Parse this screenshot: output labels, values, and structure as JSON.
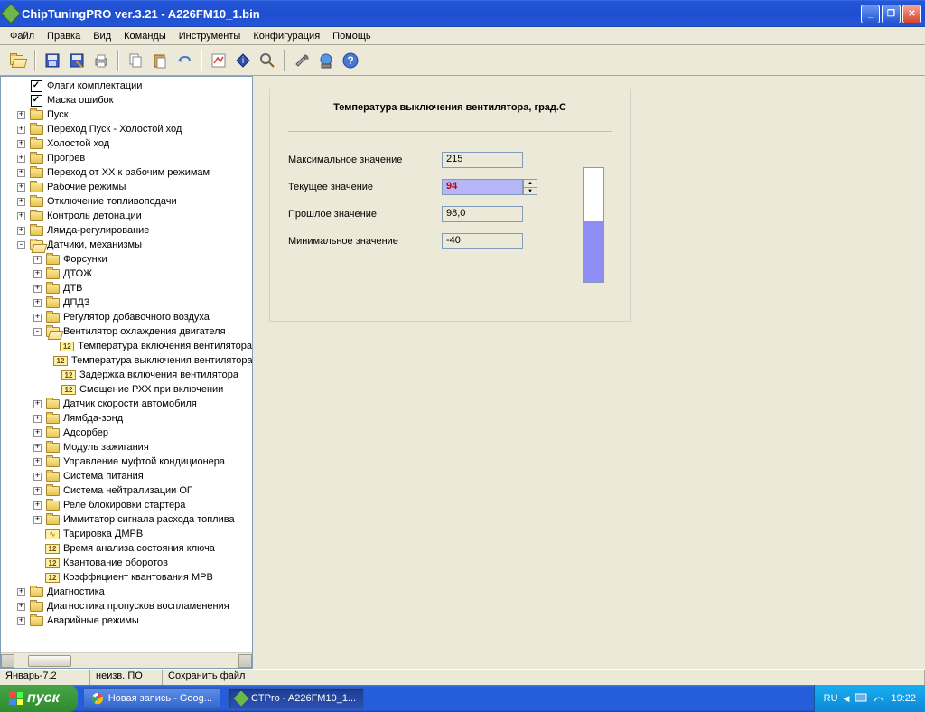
{
  "window": {
    "title": "ChipTuningPRO ver.3.21 - A226FM10_1.bin"
  },
  "menu": [
    "Файл",
    "Правка",
    "Вид",
    "Команды",
    "Инструменты",
    "Конфигурация",
    "Помощь"
  ],
  "tree": [
    {
      "lvl": 1,
      "exp": "",
      "icon": "check",
      "label": "Флаги комплектации"
    },
    {
      "lvl": 1,
      "exp": "",
      "icon": "check",
      "label": "Маска ошибок"
    },
    {
      "lvl": 1,
      "exp": "+",
      "icon": "fc",
      "label": "Пуск"
    },
    {
      "lvl": 1,
      "exp": "+",
      "icon": "fc",
      "label": "Переход Пуск - Холостой ход"
    },
    {
      "lvl": 1,
      "exp": "+",
      "icon": "fc",
      "label": "Холостой ход"
    },
    {
      "lvl": 1,
      "exp": "+",
      "icon": "fc",
      "label": "Прогрев"
    },
    {
      "lvl": 1,
      "exp": "+",
      "icon": "fc",
      "label": "Переход от XX к рабочим режимам"
    },
    {
      "lvl": 1,
      "exp": "+",
      "icon": "fc",
      "label": "Рабочие режимы"
    },
    {
      "lvl": 1,
      "exp": "+",
      "icon": "fc",
      "label": "Отключение топливоподачи"
    },
    {
      "lvl": 1,
      "exp": "+",
      "icon": "fc",
      "label": "Контроль детонации"
    },
    {
      "lvl": 1,
      "exp": "+",
      "icon": "fc",
      "label": "Лямда-регулирование"
    },
    {
      "lvl": 1,
      "exp": "-",
      "icon": "fo",
      "label": "Датчики, механизмы"
    },
    {
      "lvl": 2,
      "exp": "+",
      "icon": "fc",
      "label": "Форсунки"
    },
    {
      "lvl": 2,
      "exp": "+",
      "icon": "fc",
      "label": "ДТОЖ"
    },
    {
      "lvl": 2,
      "exp": "+",
      "icon": "fc",
      "label": "ДТВ"
    },
    {
      "lvl": 2,
      "exp": "+",
      "icon": "fc",
      "label": "ДПДЗ"
    },
    {
      "lvl": 2,
      "exp": "+",
      "icon": "fc",
      "label": "Регулятор добавочного воздуха"
    },
    {
      "lvl": 2,
      "exp": "-",
      "icon": "fo",
      "label": "Вентилятор охлаждения двигателя"
    },
    {
      "lvl": 3,
      "exp": "",
      "icon": "12",
      "label": "Температура включения вентилятора"
    },
    {
      "lvl": 3,
      "exp": "",
      "icon": "12",
      "label": "Температура выключения вентилятора"
    },
    {
      "lvl": 3,
      "exp": "",
      "icon": "12",
      "label": "Задержка включения вентилятора"
    },
    {
      "lvl": 3,
      "exp": "",
      "icon": "12",
      "label": "Смещение РХХ при включении"
    },
    {
      "lvl": 2,
      "exp": "+",
      "icon": "fc",
      "label": "Датчик скорости автомобиля"
    },
    {
      "lvl": 2,
      "exp": "+",
      "icon": "fc",
      "label": "Лямбда-зонд"
    },
    {
      "lvl": 2,
      "exp": "+",
      "icon": "fc",
      "label": "Адсорбер"
    },
    {
      "lvl": 2,
      "exp": "+",
      "icon": "fc",
      "label": "Модуль зажигания"
    },
    {
      "lvl": 2,
      "exp": "+",
      "icon": "fc",
      "label": "Управление муфтой кондиционера"
    },
    {
      "lvl": 2,
      "exp": "+",
      "icon": "fc",
      "label": "Система питания"
    },
    {
      "lvl": 2,
      "exp": "+",
      "icon": "fc",
      "label": "Система нейтрализации ОГ"
    },
    {
      "lvl": 2,
      "exp": "+",
      "icon": "fc",
      "label": "Реле блокировки стартера"
    },
    {
      "lvl": 2,
      "exp": "+",
      "icon": "fc",
      "label": "Иммитатор сигнала расхода топлива"
    },
    {
      "lvl": 2,
      "exp": "",
      "icon": "wv",
      "label": "Тарировка ДМРВ"
    },
    {
      "lvl": 2,
      "exp": "",
      "icon": "12",
      "label": "Время анализа состояния ключа"
    },
    {
      "lvl": 2,
      "exp": "",
      "icon": "12",
      "label": "Квантование оборотов"
    },
    {
      "lvl": 2,
      "exp": "",
      "icon": "12",
      "label": "Коэффициент квантования МРВ"
    },
    {
      "lvl": 1,
      "exp": "+",
      "icon": "fc",
      "label": "Диагностика"
    },
    {
      "lvl": 1,
      "exp": "+",
      "icon": "fc",
      "label": "Диагностика пропусков воспламенения"
    },
    {
      "lvl": 1,
      "exp": "+",
      "icon": "fc",
      "label": "Аварийные режимы"
    }
  ],
  "panel": {
    "title": "Температура выключения вентилятора, град.С",
    "max_label": "Максимальное значение",
    "max_val": "215",
    "cur_label": "Текущее значение",
    "cur_val": "94",
    "prev_label": "Прошлое значение",
    "prev_val": "98,0",
    "min_label": "Минимальное значение",
    "min_val": "-40"
  },
  "status": {
    "c1": "Январь-7.2",
    "c2": "неизв. ПО",
    "c3": "Сохранить файл"
  },
  "taskbar": {
    "start": "пуск",
    "tasks": [
      {
        "label": "Новая запись - Goog...",
        "icon": "chrome",
        "active": false
      },
      {
        "label": "CTPro - A226FM10_1...",
        "icon": "ctp",
        "active": true
      }
    ],
    "lang": "RU",
    "time": "19:22"
  }
}
